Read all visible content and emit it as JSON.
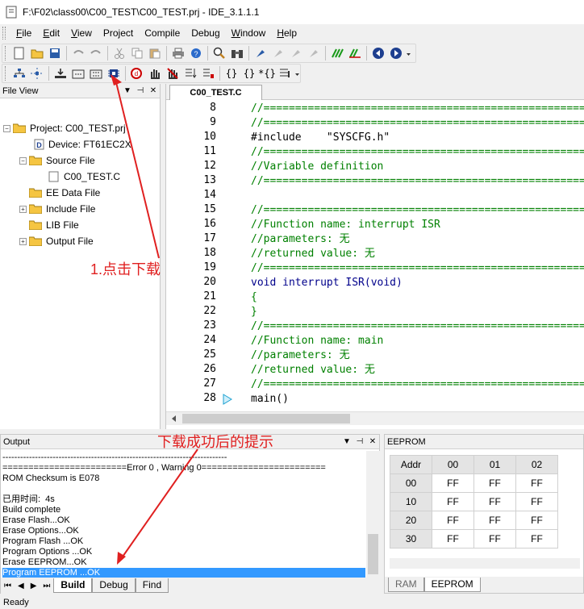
{
  "window": {
    "title": "F:\\F02\\class00\\C00_TEST\\C00_TEST.prj - IDE_3.1.1.1"
  },
  "menu": [
    {
      "label": "File",
      "u": "F",
      "rest": "ile"
    },
    {
      "label": "Edit",
      "u": "E",
      "rest": "dit"
    },
    {
      "label": "View",
      "u": "V",
      "rest": "iew"
    },
    {
      "label": "Project",
      "u": "",
      "rest": "Project"
    },
    {
      "label": "Compile",
      "u": "",
      "rest": "Compile"
    },
    {
      "label": "Debug",
      "u": "",
      "rest": "Debug"
    },
    {
      "label": "Window",
      "u": "W",
      "rest": "indow"
    },
    {
      "label": "Help",
      "u": "H",
      "rest": "elp"
    }
  ],
  "fileview": {
    "title": "File View",
    "project_label": "Project:  C00_TEST.prj",
    "device_label": "Device:  FT61EC2X",
    "source_file": "Source File",
    "source_child": "C00_TEST.C",
    "ee_data": "EE Data File",
    "include": "Include File",
    "lib": "LIB File",
    "output": "Output File"
  },
  "editor": {
    "tab": "C00_TEST.C",
    "lines": [
      {
        "n": "8",
        "t": "//================================================================",
        "c": "cm"
      },
      {
        "n": "9",
        "t": "//================================================================",
        "c": "cm"
      },
      {
        "n": "10",
        "t": "#include    \"SYSCFG.h\"",
        "c": "str"
      },
      {
        "n": "11",
        "t": "//================================================================",
        "c": "cm"
      },
      {
        "n": "12",
        "t": "//Variable definition",
        "c": "cm"
      },
      {
        "n": "13",
        "t": "//================================================================",
        "c": "cm"
      },
      {
        "n": "14",
        "t": "",
        "c": "str"
      },
      {
        "n": "15",
        "t": "//================================================================",
        "c": "cm"
      },
      {
        "n": "16",
        "t": "//Function name: interrupt ISR",
        "c": "cm"
      },
      {
        "n": "17",
        "t": "//parameters: 无",
        "c": "cm"
      },
      {
        "n": "18",
        "t": "//returned value: 无",
        "c": "cm"
      },
      {
        "n": "19",
        "t": "//================================================================",
        "c": "cm"
      },
      {
        "n": "20",
        "t": "void interrupt ISR(void)",
        "c": "kw"
      },
      {
        "n": "21",
        "t": "{",
        "c": "cm"
      },
      {
        "n": "22",
        "t": "}",
        "c": "cm"
      },
      {
        "n": "23",
        "t": "//================================================================",
        "c": "cm"
      },
      {
        "n": "24",
        "t": "//Function name: main",
        "c": "cm"
      },
      {
        "n": "25",
        "t": "//parameters: 无",
        "c": "cm"
      },
      {
        "n": "26",
        "t": "//returned value: 无",
        "c": "cm"
      },
      {
        "n": "27",
        "t": "//================================================================",
        "c": "cm"
      },
      {
        "n": "28",
        "t": "main()",
        "c": "str"
      }
    ]
  },
  "output": {
    "title": "Output",
    "lines": [
      "----------------------------------------------------------------------------",
      "========================Error 0 , Warning 0========================",
      "ROM Checksum is E078",
      "",
      "已用时间:  4s",
      "Build complete",
      "Erase Flash...OK",
      "Erase Options...OK",
      "Program Flash ...OK",
      "Program Options ...OK",
      "Erase EEPROM...OK",
      "Program EEPROM ...OK"
    ],
    "tabs": [
      "Build",
      "Debug",
      "Find"
    ]
  },
  "eeprom": {
    "title": "EEPROM",
    "headers": [
      "Addr",
      "00",
      "01",
      "02"
    ],
    "rows": [
      [
        "00",
        "FF",
        "FF",
        "FF"
      ],
      [
        "10",
        "FF",
        "FF",
        "FF"
      ],
      [
        "20",
        "FF",
        "FF",
        "FF"
      ],
      [
        "30",
        "FF",
        "FF",
        "FF"
      ]
    ],
    "tabs": [
      "RAM",
      "EEPROM"
    ]
  },
  "status": "Ready",
  "annotations": {
    "click_download": "1.点击下载",
    "download_success": "下载成功后的提示"
  }
}
